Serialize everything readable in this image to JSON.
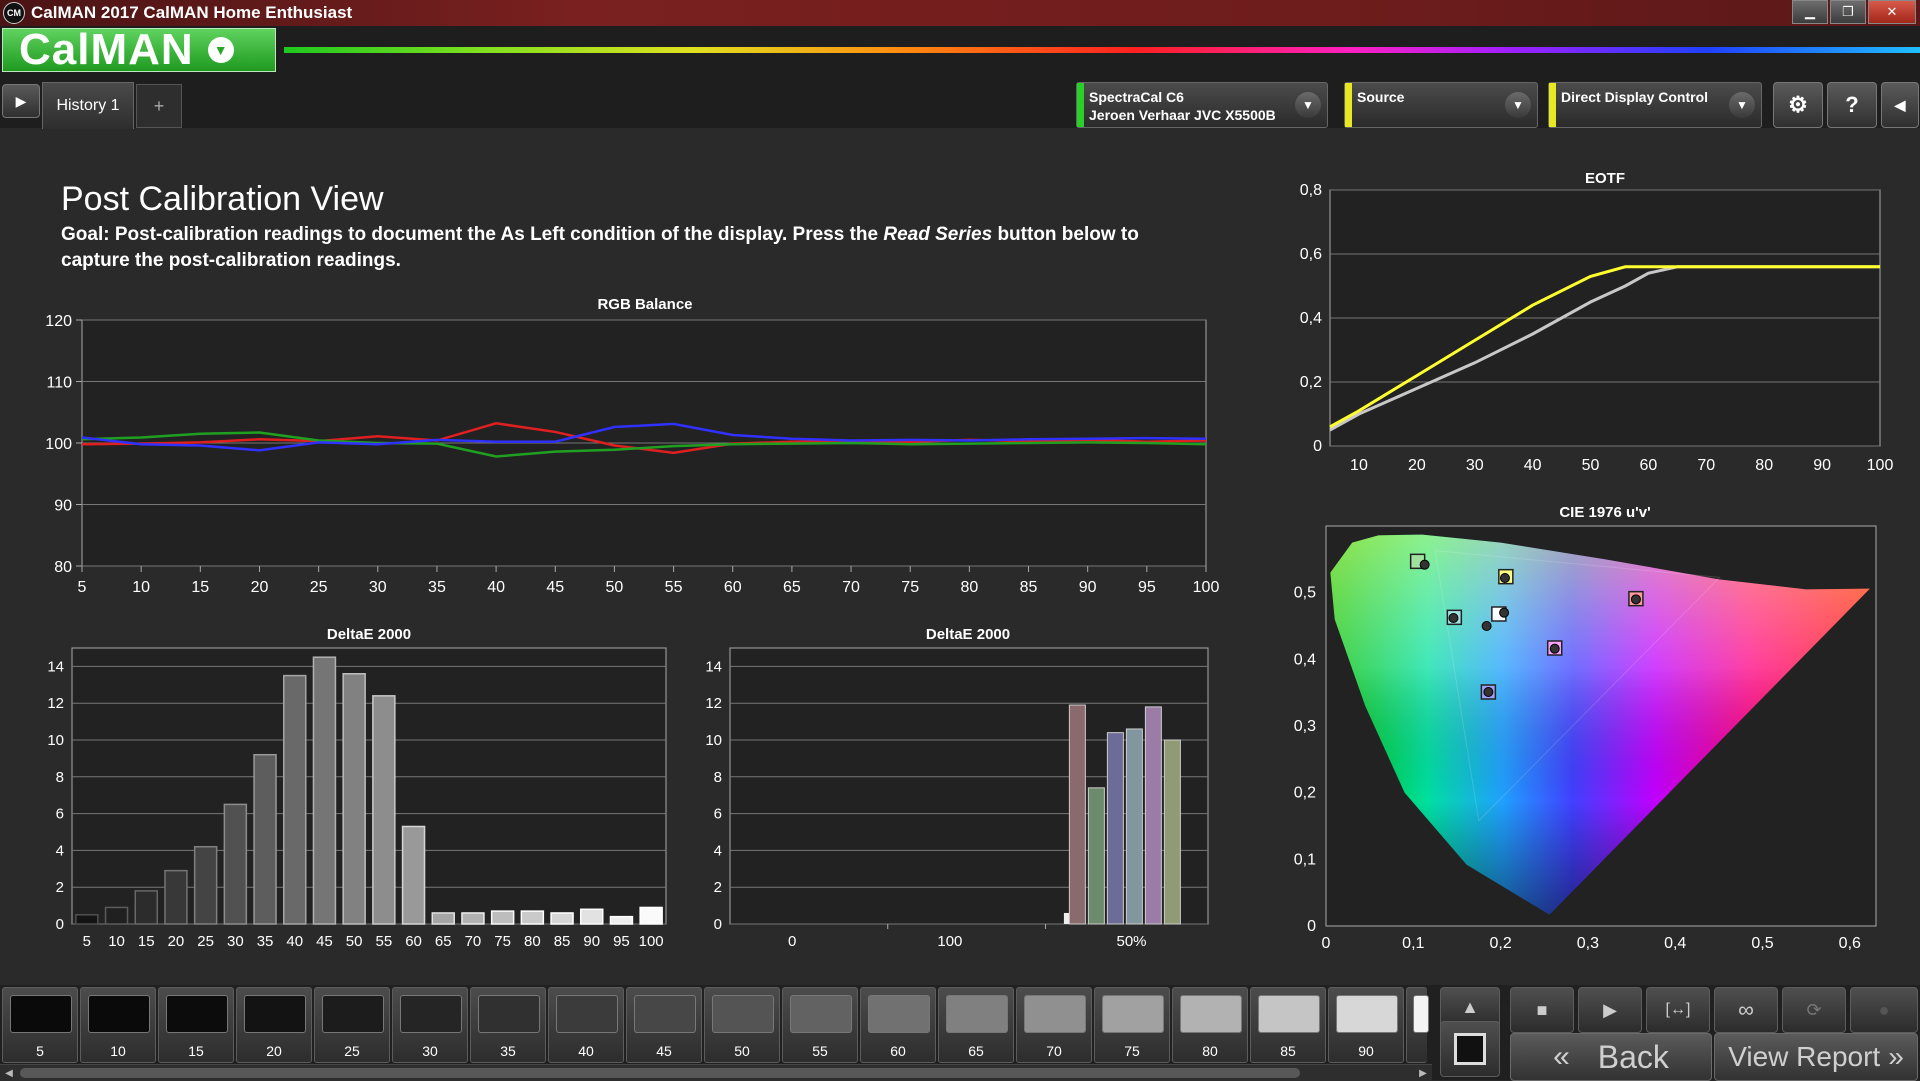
{
  "window": {
    "icon_text": "CM",
    "title": "CalMAN 2017 CalMAN Home Enthusiast",
    "min": "▁",
    "max": "❐",
    "close": "✕"
  },
  "logo": {
    "text": "CalMAN"
  },
  "toolbar": {
    "tab_label": "History 1",
    "tab_add": "+",
    "meter": {
      "line1": "SpectraCal C6",
      "line2": "Jeroen Verhaar JVC X5500B"
    },
    "source": {
      "line1": "Source"
    },
    "display_control": {
      "line1": "Direct Display Control"
    },
    "help": "?"
  },
  "main": {
    "title": "Post Calibration View",
    "goal_pre": "Goal: Post-calibration readings to document the As Left condition of the display. Press the ",
    "goal_em": "Read Series",
    "goal_post": " button below to capture the post-calibration readings."
  },
  "chart_data": [
    {
      "id": "rgb",
      "type": "line",
      "title": "RGB Balance",
      "x": [
        5,
        10,
        15,
        20,
        25,
        30,
        35,
        40,
        45,
        50,
        55,
        60,
        65,
        70,
        75,
        80,
        85,
        90,
        95,
        100
      ],
      "ylim": [
        80,
        120
      ],
      "yticks": [
        80,
        90,
        100,
        110,
        120
      ],
      "series": [
        {
          "color": "#e02020",
          "values": [
            99.8,
            99.9,
            100.1,
            100.6,
            100.3,
            101.1,
            100.4,
            103.2,
            101.8,
            99.6,
            98.4,
            99.9,
            100.2,
            100.3,
            100.2,
            100.5,
            100.3,
            100.5,
            100.2,
            100.4
          ]
        },
        {
          "color": "#20a020",
          "values": [
            100.6,
            100.9,
            101.5,
            101.7,
            100.4,
            100.0,
            99.9,
            97.8,
            98.6,
            98.9,
            99.5,
            99.8,
            99.9,
            100.0,
            99.8,
            99.9,
            100.0,
            100.1,
            100.0,
            99.8
          ]
        },
        {
          "color": "#3030ff",
          "values": [
            100.9,
            99.8,
            99.6,
            98.8,
            100.1,
            99.8,
            100.5,
            100.2,
            100.2,
            102.6,
            103.1,
            101.3,
            100.7,
            100.4,
            100.5,
            100.4,
            100.6,
            100.7,
            100.8,
            100.7
          ]
        }
      ]
    },
    {
      "id": "de_gray",
      "type": "bar",
      "title": "DeltaE 2000",
      "categories": [
        "5",
        "10",
        "15",
        "20",
        "25",
        "30",
        "35",
        "40",
        "45",
        "50",
        "55",
        "60",
        "65",
        "70",
        "75",
        "80",
        "85",
        "90",
        "95",
        "100"
      ],
      "values": [
        0.5,
        0.9,
        1.8,
        2.9,
        4.2,
        6.5,
        9.2,
        13.5,
        14.5,
        13.6,
        12.4,
        5.3,
        0.6,
        0.6,
        0.7,
        0.7,
        0.6,
        0.8,
        0.4,
        0.9
      ],
      "ylim": [
        0,
        15
      ],
      "yticks": [
        0,
        2,
        4,
        6,
        8,
        10,
        12,
        14
      ]
    },
    {
      "id": "de_color",
      "type": "bar",
      "title": "DeltaE 2000",
      "x_labels": [
        "0",
        "100",
        "50%"
      ],
      "small_bar": {
        "x": 128,
        "value": 0.6
      },
      "bars": [
        {
          "value": 11.9,
          "color": "#8a6a6c"
        },
        {
          "value": 7.4,
          "color": "#6c8a6c"
        },
        {
          "value": 10.4,
          "color": "#6c6c96"
        },
        {
          "value": 10.6,
          "color": "#8296a0"
        },
        {
          "value": 11.8,
          "color": "#9a7ca6"
        },
        {
          "value": 10.0,
          "color": "#909a74"
        }
      ],
      "ylim": [
        0,
        15
      ],
      "yticks": [
        0,
        2,
        4,
        6,
        8,
        10,
        12,
        14
      ]
    },
    {
      "id": "eotf",
      "type": "line",
      "title": "EOTF",
      "x": [
        5,
        10,
        20,
        30,
        40,
        50,
        56,
        60,
        65,
        70,
        80,
        90,
        100
      ],
      "xticks": [
        10,
        20,
        30,
        40,
        50,
        60,
        70,
        80,
        90,
        100
      ],
      "xlim": [
        5,
        100
      ],
      "ylim": [
        0,
        0.8
      ],
      "yticks": [
        "0",
        "0,2",
        "0,4",
        "0,6",
        "0,8"
      ],
      "series": [
        {
          "color": "#c8c8c8",
          "values": [
            0.05,
            0.1,
            0.18,
            0.26,
            0.35,
            0.45,
            0.5,
            0.54,
            0.56,
            0.56,
            0.56,
            0.56,
            0.56
          ]
        },
        {
          "color": "#ffff30",
          "values": [
            0.06,
            0.11,
            0.22,
            0.33,
            0.44,
            0.53,
            0.56,
            0.56,
            0.56,
            0.56,
            0.56,
            0.56,
            0.56
          ]
        }
      ]
    },
    {
      "id": "cie",
      "type": "scatter",
      "title": "CIE 1976 u'v'",
      "xlim": [
        0,
        0.63
      ],
      "ylim": [
        0,
        0.6
      ],
      "xticks": [
        "0",
        "0,1",
        "0,2",
        "0,3",
        "0,4",
        "0,5",
        "0,6"
      ],
      "yticks": [
        "0",
        "0,1",
        "0,2",
        "0,3",
        "0,4",
        "0,5"
      ],
      "targets": [
        {
          "u": 0.105,
          "v": 0.547,
          "fill": "#9fe39f"
        },
        {
          "u": 0.147,
          "v": 0.463,
          "fill": "#9fe3e3"
        },
        {
          "u": 0.198,
          "v": 0.468,
          "fill": "#ffffff"
        },
        {
          "u": 0.206,
          "v": 0.524,
          "fill": "#ffff80"
        },
        {
          "u": 0.355,
          "v": 0.491,
          "fill": "#ff9a9a"
        },
        {
          "u": 0.262,
          "v": 0.417,
          "fill": "#ffa0ff"
        },
        {
          "u": 0.186,
          "v": 0.351,
          "fill": "#a0a0ff"
        }
      ],
      "measured": [
        {
          "u": 0.113,
          "v": 0.542
        },
        {
          "u": 0.146,
          "v": 0.462
        },
        {
          "u": 0.204,
          "v": 0.47
        },
        {
          "u": 0.205,
          "v": 0.522
        },
        {
          "u": 0.355,
          "v": 0.49
        },
        {
          "u": 0.262,
          "v": 0.416
        },
        {
          "u": 0.186,
          "v": 0.351
        },
        {
          "u": 0.184,
          "v": 0.45
        }
      ]
    }
  ],
  "swatches": {
    "labels": [
      "5",
      "10",
      "15",
      "20",
      "25",
      "30",
      "35",
      "40",
      "45",
      "50",
      "55",
      "60",
      "65",
      "70",
      "75",
      "80",
      "85",
      "90"
    ],
    "levels": [
      5,
      10,
      15,
      20,
      25,
      30,
      35,
      40,
      45,
      50,
      55,
      60,
      65,
      70,
      75,
      80,
      85,
      90
    ]
  },
  "controls": {
    "back": "Back",
    "view_report": "View Report",
    "back_icon": "«",
    "report_icon": "»"
  }
}
